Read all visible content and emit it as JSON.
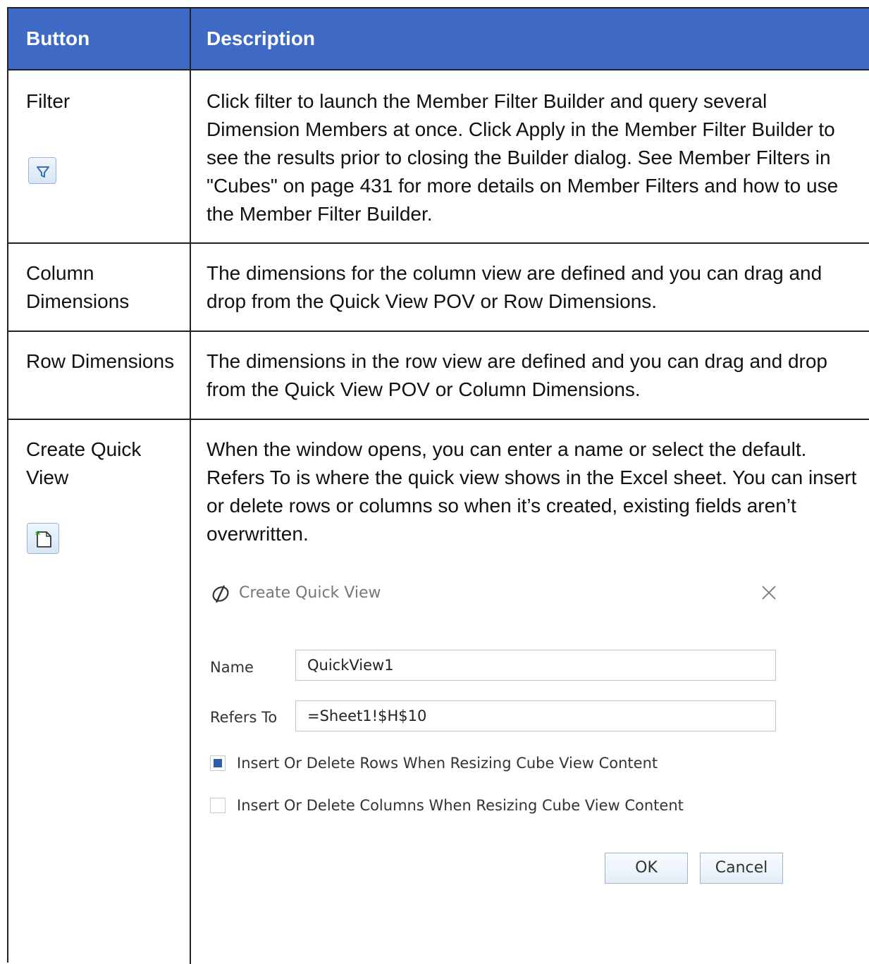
{
  "header": {
    "col1": "Button",
    "col2": "Description"
  },
  "rows": [
    {
      "name": "Filter",
      "icon": "filter-icon",
      "description": "Click filter to launch the Member Filter Builder and query several Dimension Members at once.  Click Apply in the Member Filter Builder to see the results prior to closing the Builder dialog.  See Member Filters in \"Cubes\" on page 431 for more details on Member Filters and how to use the Member Filter Builder."
    },
    {
      "name": "Column Dimensions",
      "description": "The dimensions for the column view are defined and you can drag and drop from the Quick View POV or Row Dimensions."
    },
    {
      "name": "Row Dimensions",
      "description": "The dimensions in the row view are defined and you can drag and drop from the Quick View POV or Column Dimensions."
    },
    {
      "name": "Create Quick View",
      "icon": "new-document-icon",
      "description": "When the window opens, you can enter a name or select the default. Refers To is where the quick view shows in the Excel sheet. You can insert or delete rows or columns so when it’s created, existing fields aren’t overwritten."
    }
  ],
  "dialog": {
    "title": "Create Quick View",
    "name_label": "Name",
    "name_value": "QuickView1",
    "refers_label": "Refers To",
    "refers_value": "=Sheet1!$H$10",
    "check_rows_label": "Insert Or Delete Rows When Resizing Cube View Content",
    "check_rows_checked": true,
    "check_cols_label": "Insert Or Delete Columns When Resizing Cube View Content",
    "check_cols_checked": false,
    "ok_label": "OK",
    "cancel_label": "Cancel"
  },
  "colors": {
    "header_bg": "#3e6ac6",
    "border": "#222222"
  }
}
